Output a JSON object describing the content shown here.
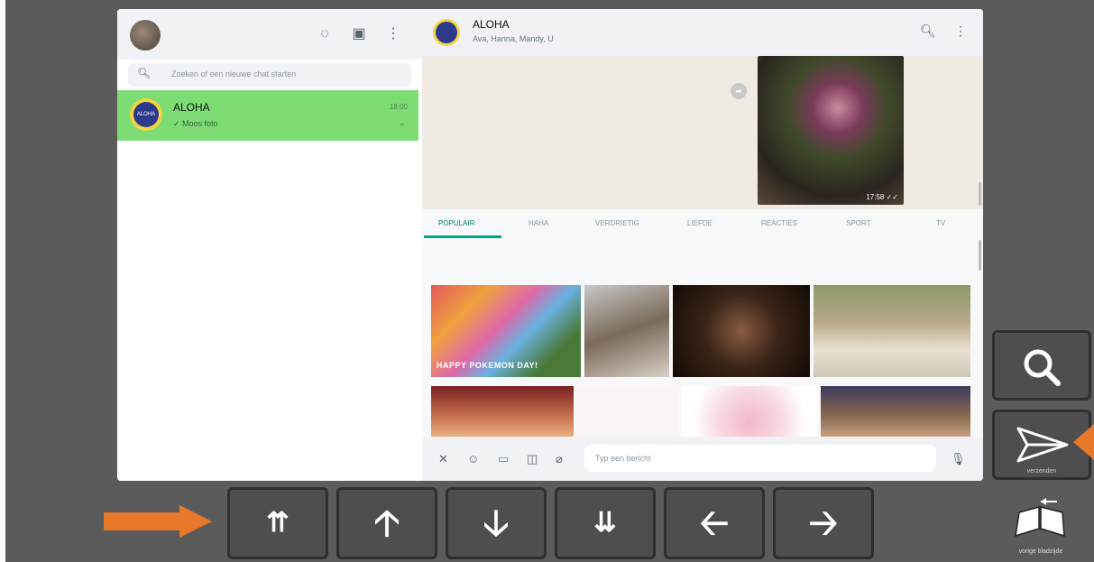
{
  "left_pane": {
    "search_placeholder": "Zoeken of een nieuwe chat starten",
    "chat": {
      "name": "ALOHA",
      "avatar_text": "ALOHA",
      "last_message": "✓ Moos foto",
      "time": "18:00"
    }
  },
  "right_pane": {
    "group_name": "ALOHA",
    "members": "Ava, Hanna, Mandy, U",
    "photo_time": "17:58 ✓✓",
    "tabs": [
      "POPULAIR",
      "HAHA",
      "VERDRIETIG",
      "LIEFDE",
      "REACTIES",
      "SPORT",
      "TV"
    ],
    "gifs": {
      "pikachu_caption": "HAPPY POKEMON DAY!"
    },
    "compose_placeholder": "Typ een bericht"
  },
  "side_controls": {
    "search_label": "",
    "send_label": "verzenden",
    "whole_screen_label": "vorige bladzijde"
  },
  "nav_buttons": {
    "page_up": "⇈",
    "up": "🡡",
    "down": "🡣",
    "page_down": "⇊",
    "left": "🡠",
    "right": "🡢"
  },
  "colors": {
    "selected_chat": "#7ddc74",
    "accent": "#00a884",
    "control_bg": "#4e4e4e",
    "pointer_arrow": "#e8782a"
  }
}
